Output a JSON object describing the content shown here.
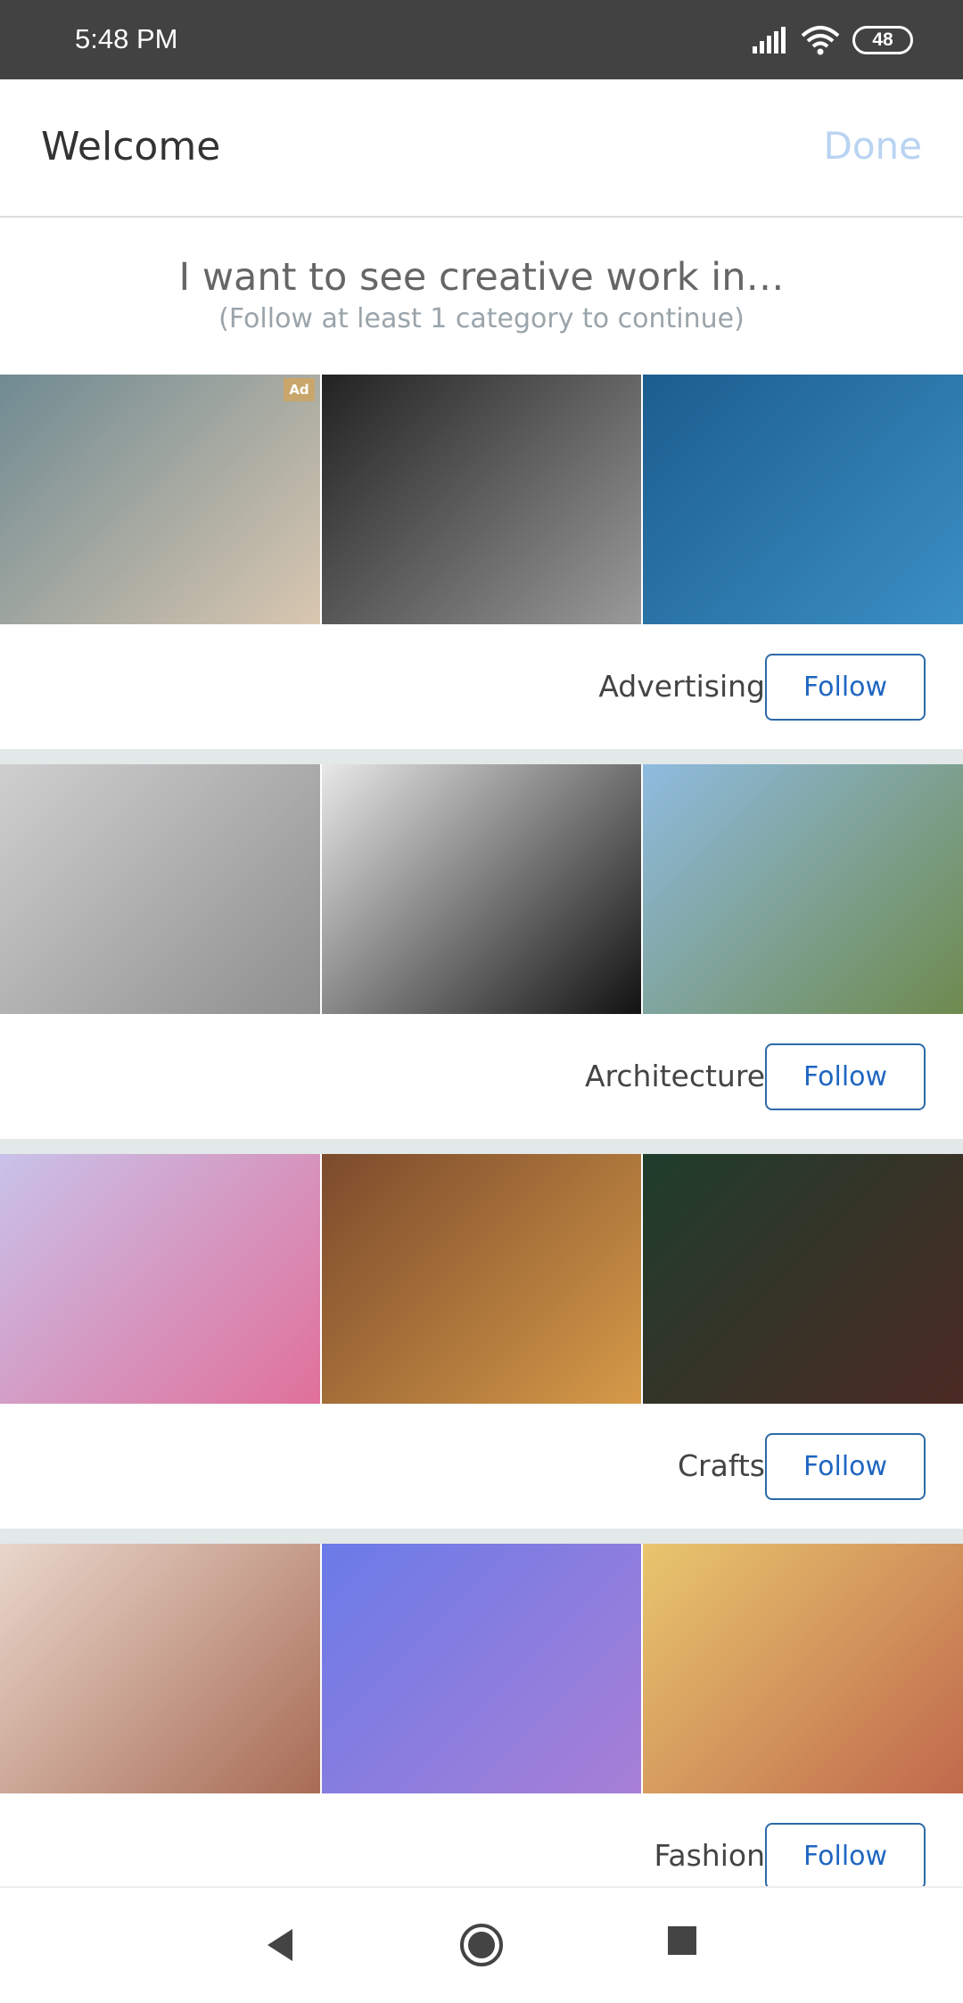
{
  "status_bar": {
    "time": "5:48 PM",
    "battery": "48",
    "icons": [
      "signal-icon",
      "wifi-icon",
      "battery-icon"
    ]
  },
  "header": {
    "title": "Welcome",
    "done_label": "Done",
    "done_color": "#b9d3f2"
  },
  "intro": {
    "heading": "I want to see creative work in…",
    "subheading": "(Follow at least 1 category to continue)"
  },
  "accent_color": "#1f66c1",
  "categories": [
    {
      "name": "Advertising",
      "follow_label": "Follow",
      "ad_badge": "Ad",
      "tiles": [
        [
          "#6f8a92",
          "#d9c7b0"
        ],
        [
          "#222",
          "#9a9a9a"
        ],
        [
          "#1c5d8f",
          "#3b8fc4"
        ]
      ]
    },
    {
      "name": "Architecture",
      "follow_label": "Follow",
      "tiles": [
        [
          "#cfcfcf",
          "#8e8e8e"
        ],
        [
          "#e8e8e8",
          "#111"
        ],
        [
          "#8fbbe0",
          "#6e8a4e"
        ]
      ]
    },
    {
      "name": "Crafts",
      "follow_label": "Follow",
      "tiles": [
        [
          "#c9c2ea",
          "#e0709a"
        ],
        [
          "#7b4a2c",
          "#d69a48"
        ],
        [
          "#1f3d2c",
          "#4b2a24"
        ]
      ]
    },
    {
      "name": "Fashion",
      "follow_label": "Follow",
      "tiles": [
        [
          "#e9d7cc",
          "#a86c55"
        ],
        [
          "#6a7be8",
          "#a87fd6"
        ],
        [
          "#e8c66e",
          "#c0694c"
        ]
      ]
    }
  ],
  "nav_bar": {
    "icons": [
      "back-icon",
      "home-icon",
      "recents-icon"
    ]
  }
}
